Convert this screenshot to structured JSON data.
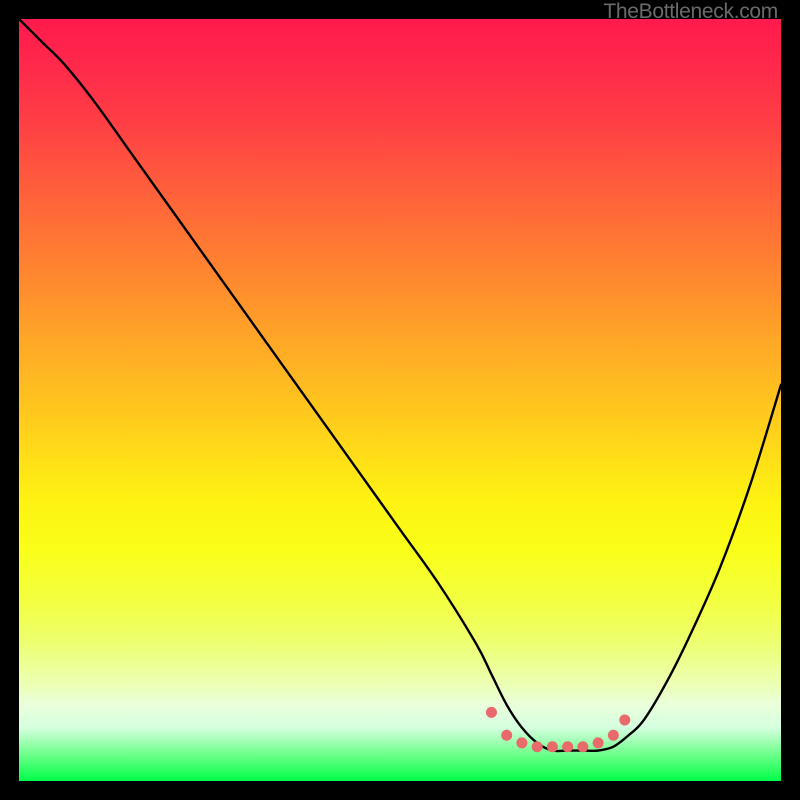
{
  "attribution": "TheBottleneck.com",
  "chart_data": {
    "type": "line",
    "title": "",
    "xlabel": "",
    "ylabel": "",
    "xlim": [
      0,
      100
    ],
    "ylim": [
      0,
      100
    ],
    "series": [
      {
        "name": "bottleneck-curve",
        "x": [
          0,
          3,
          6,
          10,
          15,
          20,
          25,
          30,
          35,
          40,
          45,
          50,
          55,
          60,
          62,
          64,
          66,
          68,
          70,
          72,
          74,
          76,
          78,
          80,
          82,
          85,
          88,
          92,
          96,
          100
        ],
        "y": [
          100,
          97,
          94,
          89,
          82,
          75,
          68,
          61,
          54,
          47,
          40,
          33,
          26,
          18,
          14,
          10,
          7,
          5,
          4,
          4,
          4,
          4,
          4.5,
          6,
          8,
          13,
          19,
          28,
          39,
          52
        ]
      }
    ],
    "markers": {
      "name": "highlight-dots",
      "color": "#e86a6a",
      "points": [
        {
          "x": 62,
          "y": 9
        },
        {
          "x": 64,
          "y": 6
        },
        {
          "x": 66,
          "y": 5
        },
        {
          "x": 68,
          "y": 4.5
        },
        {
          "x": 70,
          "y": 4.5
        },
        {
          "x": 72,
          "y": 4.5
        },
        {
          "x": 74,
          "y": 4.5
        },
        {
          "x": 76,
          "y": 5
        },
        {
          "x": 78,
          "y": 6
        },
        {
          "x": 79.5,
          "y": 8
        }
      ]
    }
  }
}
